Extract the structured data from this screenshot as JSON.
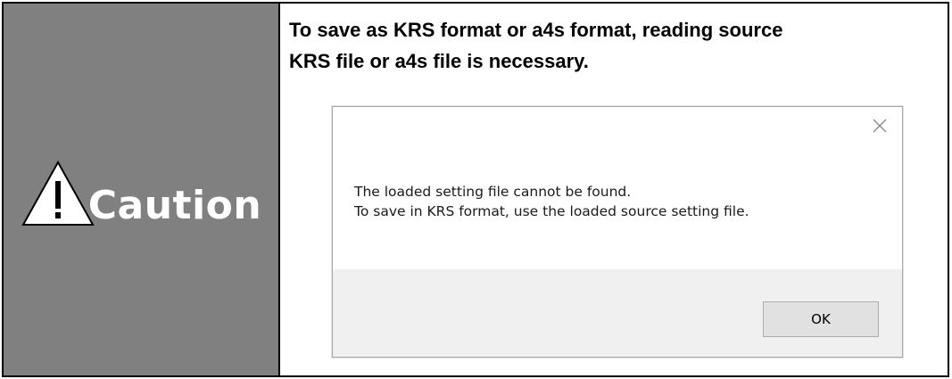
{
  "caution": {
    "label": "Caution",
    "icon": "warning-triangle-icon",
    "background_color": "#808080"
  },
  "message": {
    "line1": "To save as KRS format or a4s format, reading source",
    "line2": "KRS file or a4s file is necessary."
  },
  "dialog": {
    "close_icon": "close-icon",
    "body_line1": "The loaded setting file cannot be found.",
    "body_line2": "To save in KRS format, use the loaded source setting file.",
    "ok_label": "OK"
  }
}
